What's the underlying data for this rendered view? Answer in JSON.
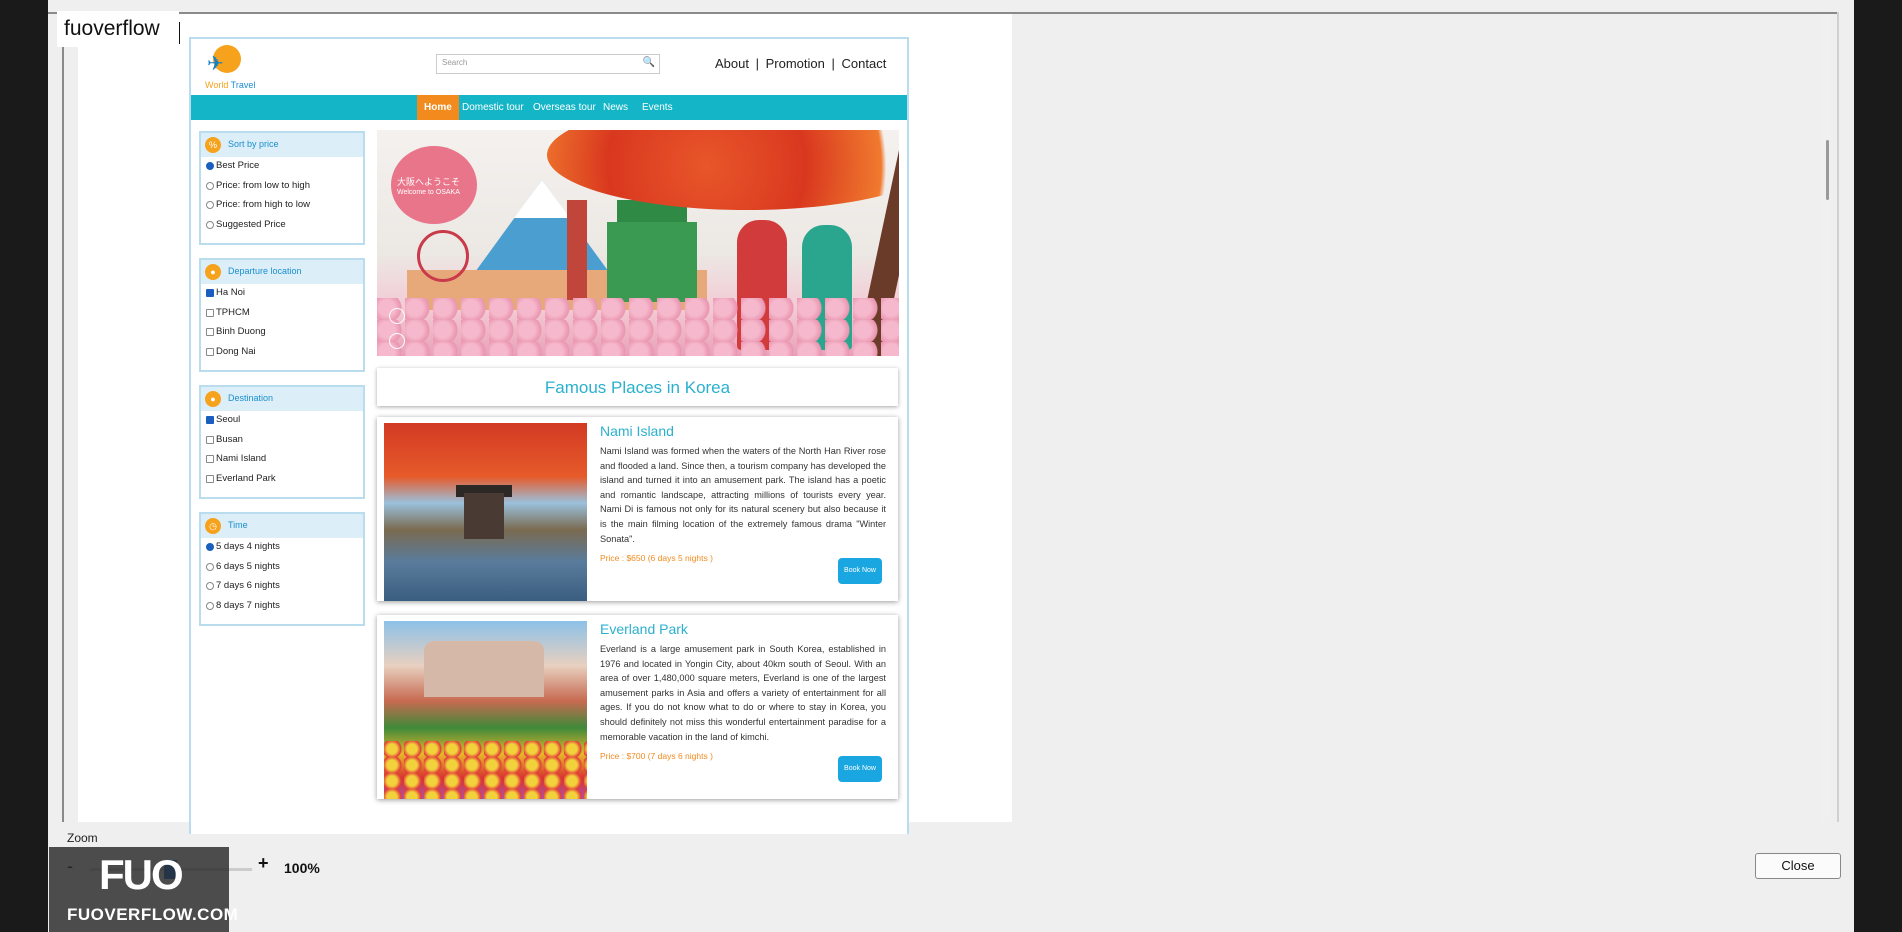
{
  "app": {
    "title": "fuoverflow"
  },
  "site": {
    "logo_text_a": "World",
    "logo_text_b": " Travel",
    "search_placeholder": "Search",
    "top_links": {
      "about": "About",
      "sep1": "|",
      "promotion": "Promotion",
      "sep2": "|",
      "contact": "Contact"
    },
    "nav": [
      "Home",
      "Domestic tour",
      "Overseas tour",
      "News",
      "Events"
    ],
    "filters": [
      {
        "title": "Sort by price",
        "type": "radio",
        "options": [
          "Best Price",
          "Price: from low to high",
          "Price: from high to low",
          "Suggested Price"
        ],
        "selected": 0
      },
      {
        "title": "Departure location",
        "type": "checkbox",
        "options": [
          "Ha Noi",
          "TPHCM",
          "Binh Duong",
          "Dong Nai"
        ],
        "selected": 0
      },
      {
        "title": "Destination",
        "type": "checkbox",
        "options": [
          "Seoul",
          "Busan",
          "Nami Island",
          "Everland Park"
        ],
        "selected": 0
      },
      {
        "title": "Time",
        "type": "radio",
        "options": [
          "5 days 4 nights",
          "6 days 5 nights",
          "7 days 6 nights",
          "8 days 7 nights"
        ],
        "selected": 0
      }
    ],
    "banner": {
      "line1": "大阪へようこそ",
      "line2": "Welcome to OSAKA"
    },
    "section_heading": "Famous Places in Korea",
    "places": [
      {
        "name": "Nami Island",
        "description": "Nami Island was formed when the waters of the North Han River rose and flooded a land. Since then, a tourism company has developed the island and turned it into an amusement park. The island has a poetic and romantic landscape, attracting millions of tourists every year. Nami Di is famous not only for its natural scenery but also because it is the main filming location of the extremely famous drama \"Winter Sonata\".",
        "price": "Price : $650 (6 days 5 nights )",
        "button": "Book Now"
      },
      {
        "name": "Everland Park",
        "description": "Everland is a large amusement park in South Korea, established in 1976 and located in Yongin City, about 40km south of Seoul. With an area of over 1,480,000 square meters, Everland is one of the largest amusement parks in Asia and offers a variety of entertainment for all ages. If you do not know what to do or where to stay in Korea, you should definitely not miss this wonderful entertainment paradise for a memorable vacation in the land of kimchi.",
        "price": "Price : $700 (7 days 6 nights )",
        "button": "Book Now"
      }
    ]
  },
  "bottom": {
    "zoom_label": "Zoom",
    "zoom_minus": "-",
    "zoom_plus": "+",
    "zoom_value": "100%",
    "close": "Close"
  },
  "watermark": {
    "logo": "FUO",
    "text": "FUOVERFLOW.COM"
  },
  "colors": {
    "nav_bg": "#14b5c6",
    "nav_active": "#f28a1e",
    "heading": "#2bb0cf",
    "price": "#f28a1e",
    "button": "#1aa6e0"
  }
}
